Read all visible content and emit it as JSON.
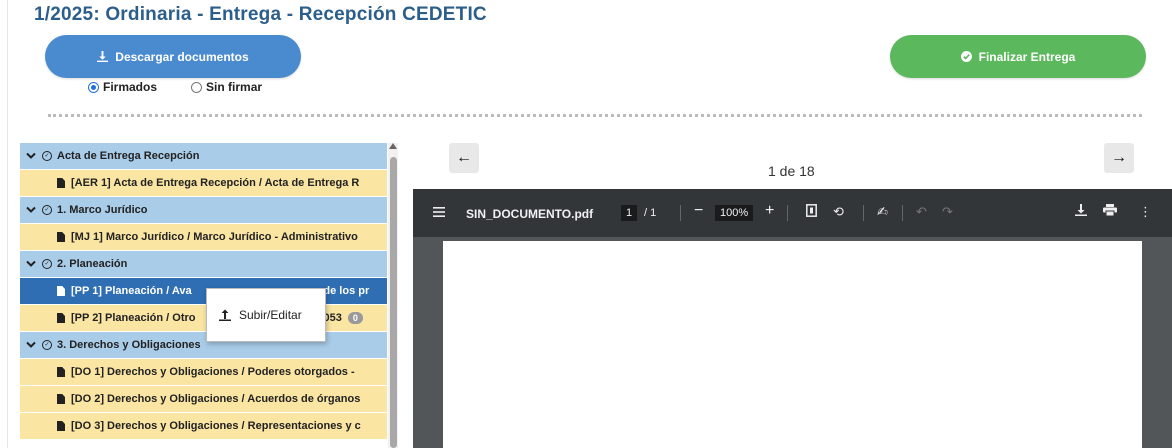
{
  "header": {
    "title": "1/2025: Ordinaria - Entrega - Recepción CEDETIC"
  },
  "actions": {
    "download_label": "Descargar documentos",
    "finish_label": "Finalizar Entrega"
  },
  "filter": {
    "options": [
      {
        "label": "Firmados",
        "checked": true
      },
      {
        "label": "Sin firmar",
        "checked": false
      }
    ]
  },
  "tree": {
    "rows": [
      {
        "kind": "category",
        "label": "Acta de Entrega Recepción"
      },
      {
        "kind": "document",
        "label": "[AER 1] Acta de Entrega Recepción / Acta de Entrega R"
      },
      {
        "kind": "category",
        "label": "1. Marco Jurídico"
      },
      {
        "kind": "document",
        "label": "[MJ 1] Marco Jurídico / Marco Jurídico - Administrativo"
      },
      {
        "kind": "category",
        "label": "2. Planeación"
      },
      {
        "kind": "document",
        "label": "[PP 1] Planeación / Ava",
        "tail": "o de los pr",
        "selected": true
      },
      {
        "kind": "document",
        "label": "[PP 2] Planeación / Otro",
        "tail": "053",
        "badge": "0"
      },
      {
        "kind": "category",
        "label": "3. Derechos y Obligaciones"
      },
      {
        "kind": "document",
        "label": "[DO 1] Derechos y Obligaciones / Poderes otorgados -"
      },
      {
        "kind": "document",
        "label": "[DO 2] Derechos y Obligaciones / Acuerdos de órganos"
      },
      {
        "kind": "document",
        "label": "[DO 3] Derechos y Obligaciones / Representaciones y c"
      }
    ]
  },
  "context_menu": {
    "item_label": "Subir/Editar"
  },
  "viewer": {
    "page_counter": "1 de 18",
    "file_name": "SIN_DOCUMENTO.pdf",
    "current_page": "1",
    "total_pages": "/ 1",
    "zoom": "100%"
  },
  "colors": {
    "category_row": "#a9cce8",
    "document_row": "#fae5a3",
    "selected_row": "#2f6eb3",
    "download_button": "#4a8bcf",
    "finish_button": "#5cb85c"
  }
}
